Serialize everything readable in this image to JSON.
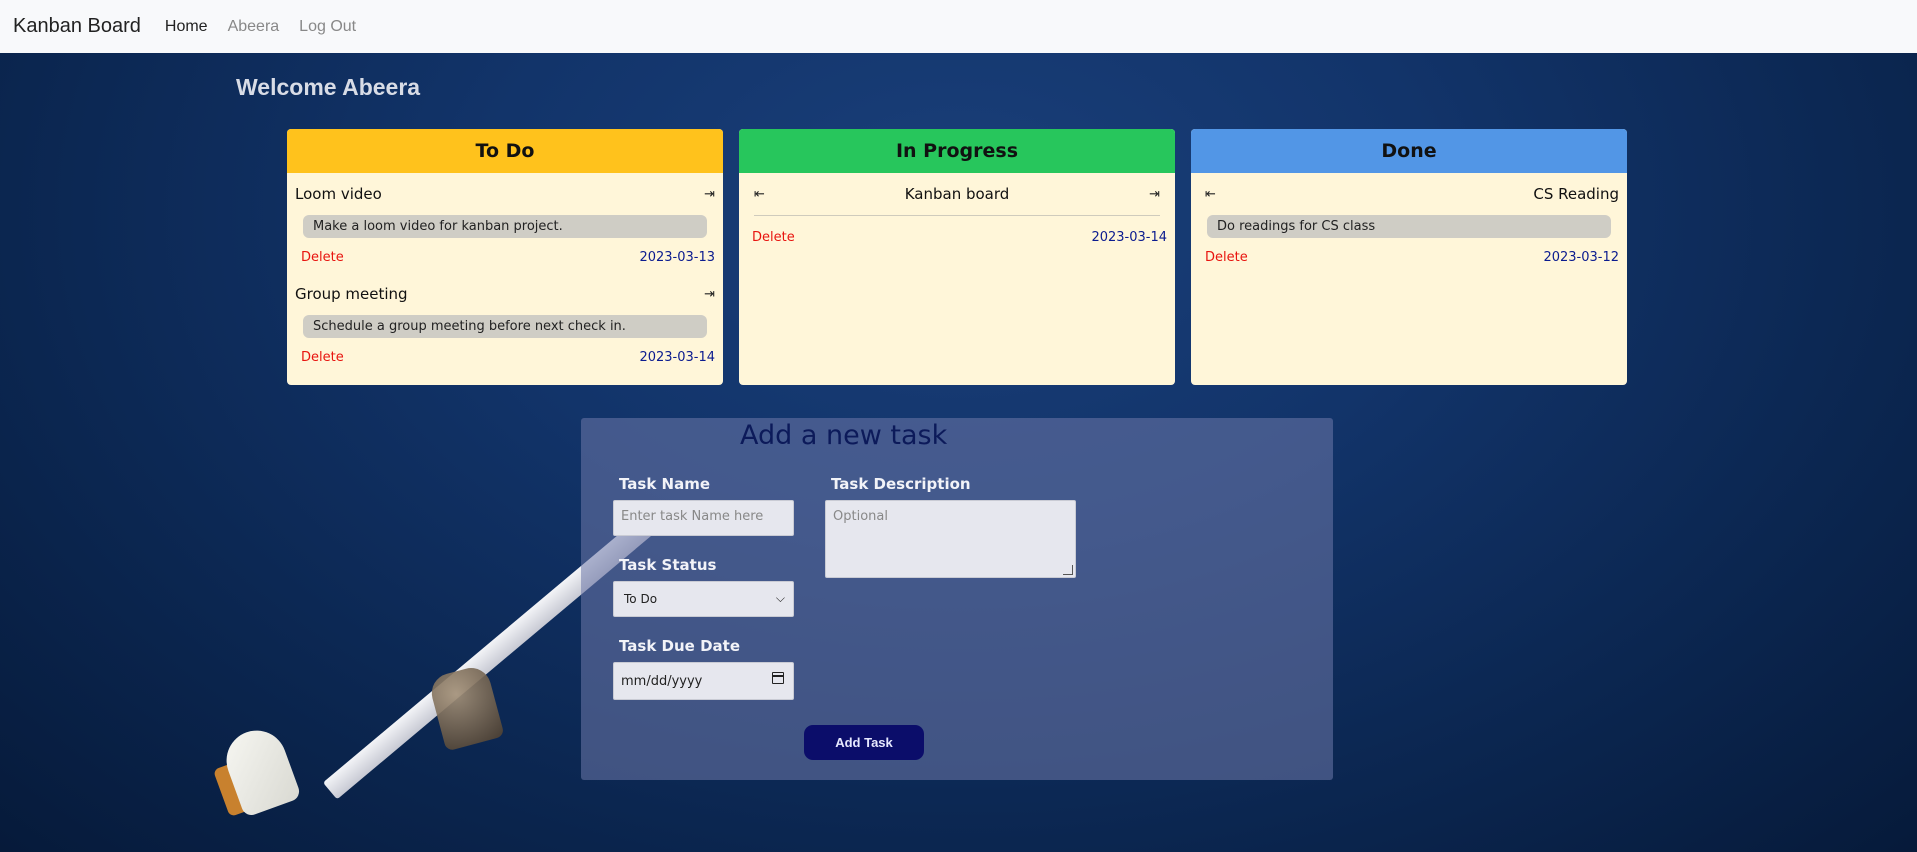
{
  "navbar": {
    "brand": "Kanban Board",
    "links": [
      "Home",
      "Abeera",
      "Log Out"
    ]
  },
  "welcome": "Welcome Abeera",
  "columns": [
    {
      "title": "To Do",
      "color": "#ffc21c",
      "tasks": [
        {
          "name": "Loom video",
          "description": "Make a loom video for kanban project.",
          "delete": "Delete",
          "date": "2023-03-13",
          "arrow_right": "⇥"
        },
        {
          "name": "Group meeting",
          "description": "Schedule a group meeting before next check in.",
          "delete": "Delete",
          "date": "2023-03-14",
          "arrow_right": "⇥"
        }
      ]
    },
    {
      "title": "In Progress",
      "color": "#27c65c",
      "tasks": [
        {
          "name": "Kanban board",
          "description": "",
          "delete": "Delete",
          "date": "2023-03-14",
          "arrow_left": "⇤",
          "arrow_right": "⇥"
        }
      ]
    },
    {
      "title": "Done",
      "color": "#5296e6",
      "tasks": [
        {
          "name": "CS Reading",
          "description": "Do readings for CS class",
          "delete": "Delete",
          "date": "2023-03-12",
          "arrow_left": "⇤"
        }
      ]
    }
  ],
  "form": {
    "title": "Add a new task",
    "task_name_label": "Task Name",
    "task_name_placeholder": "Enter task Name here",
    "task_description_label": "Task Description",
    "task_description_placeholder": "Optional",
    "task_status_label": "Task Status",
    "task_status_value": "To Do",
    "task_due_date_label": "Task Due Date",
    "task_due_date_placeholder": "mm/dd/yyyy",
    "add_button": "Add Task"
  },
  "colors": {
    "delete": "#e8140f",
    "date": "#0b1b8f",
    "button": "#0b0d6a"
  }
}
